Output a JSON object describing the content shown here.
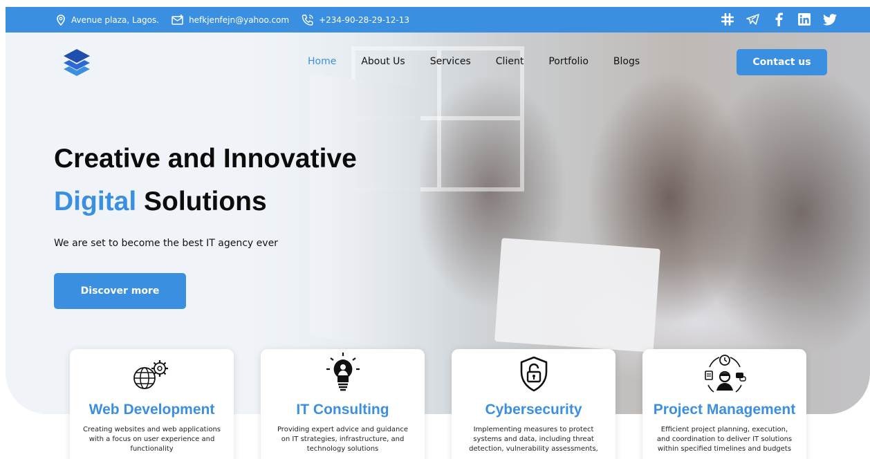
{
  "topbar": {
    "address": "Avenue plaza, Lagos.",
    "email": "hefkjenfejn@yahoo.com",
    "phone": "+234-90-28-29-12-13",
    "social_icons": [
      "slack-icon",
      "telegram-icon",
      "facebook-icon",
      "linkedin-icon",
      "twitter-icon"
    ]
  },
  "nav": {
    "items": [
      "Home",
      "About Us",
      "Services",
      "Client",
      "Portfolio",
      "Blogs"
    ],
    "active": "Home",
    "contact_label": "Contact us"
  },
  "hero": {
    "title_line1": "Creative and Innovative",
    "title_blue": "Digital",
    "title_rest": "Solutions",
    "subtitle": "We are set to become the best IT agency ever",
    "cta_label": "Discover more"
  },
  "services": [
    {
      "title": "Web Development",
      "icon": "globe-gear-icon",
      "text": "Creating websites and web applications with a focus on user experience and functionality"
    },
    {
      "title": "IT Consulting",
      "icon": "lightbulb-person-icon",
      "text": "Providing expert advice and guidance on IT strategies, infrastructure, and technology solutions"
    },
    {
      "title": "Cybersecurity",
      "icon": "shield-lock-icon",
      "text": "Implementing measures to protect systems and data, including threat detection, vulnerability assessments,"
    },
    {
      "title": "Project Management",
      "icon": "team-clock-icon",
      "text": "Efficient project planning, execution, and coordination to deliver IT solutions within specified timelines and budgets"
    }
  ],
  "colors": {
    "accent": "#3b8fe0",
    "text": "#111111"
  }
}
